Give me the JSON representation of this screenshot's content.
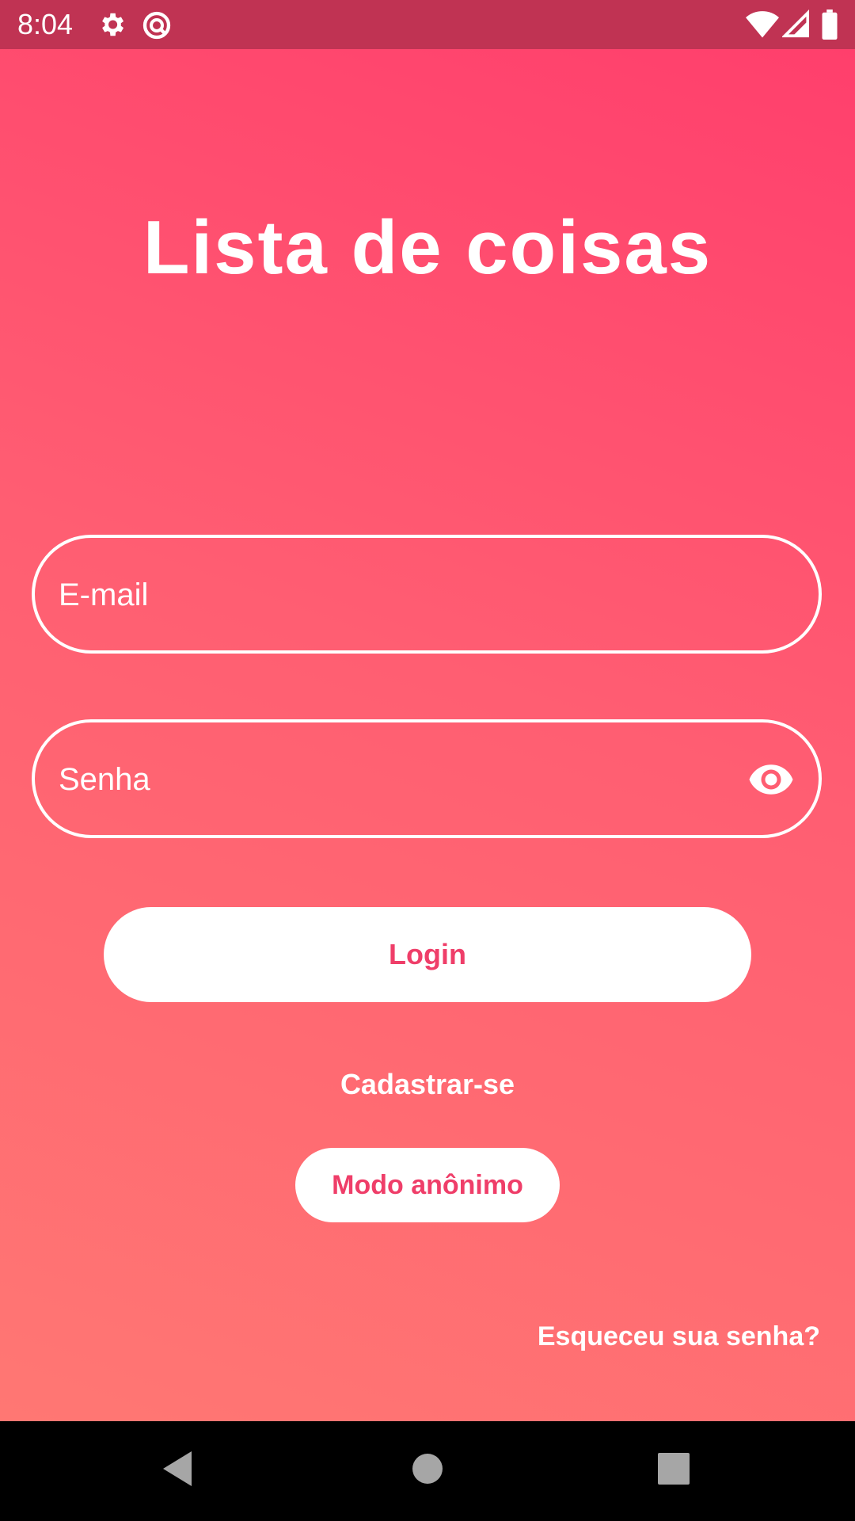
{
  "status_bar": {
    "time": "8:04",
    "icons": [
      "gear-icon",
      "app-notification-icon",
      "wifi-icon",
      "signal-icon",
      "battery-icon"
    ]
  },
  "app": {
    "title": "Lista de coisas"
  },
  "form": {
    "email": {
      "placeholder": "E-mail",
      "value": ""
    },
    "password": {
      "placeholder": "Senha",
      "value": "",
      "toggle_icon": "eye-icon"
    },
    "login_label": "Login",
    "signup_label": "Cadastrar-se",
    "anonymous_label": "Modo anônimo",
    "forgot_label": "Esqueceu sua senha?"
  },
  "nav_bar": {
    "icons": [
      "back-icon",
      "home-icon",
      "recents-icon"
    ]
  },
  "colors": {
    "status_bar": "#c03353",
    "gradient_top": "#ff3d6c",
    "gradient_bottom": "#ff7a73",
    "accent_text": "#ef3e69",
    "white": "#ffffff"
  }
}
